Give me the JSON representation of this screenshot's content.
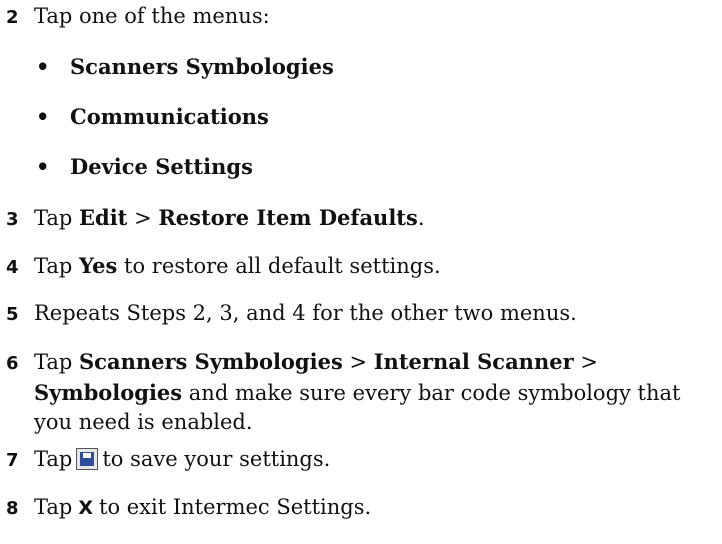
{
  "step2": {
    "num": "2",
    "text": "Tap one of the menus:",
    "bullets": [
      "Scanners Symbologies",
      "Communications",
      "Device Settings"
    ],
    "bullet_glyph": "•"
  },
  "step3": {
    "num": "3",
    "pre": "Tap ",
    "b1": "Edit",
    "sep": " > ",
    "b2": "Restore Item Defaults",
    "post": "."
  },
  "step4": {
    "num": "4",
    "pre": "Tap ",
    "b1": "Yes",
    "post": " to restore all default settings."
  },
  "step5": {
    "num": "5",
    "text": "Repeats Steps 2, 3, and 4 for the other two menus."
  },
  "step6": {
    "num": "6",
    "pre": "Tap ",
    "b1": "Scanners Symbologies",
    "sep1": " > ",
    "b2": "Internal Scanner",
    "sep2": " >",
    "b3": "Symbologies",
    "post_line2": " and make sure every bar code symbology that",
    "line3": "you need is enabled."
  },
  "step7": {
    "num": "7",
    "pre": "Tap",
    "icon": "save-icon",
    "post": "to save your settings."
  },
  "step8": {
    "num": "8",
    "pre": "Tap",
    "icon_glyph": "X",
    "post": "to exit Intermec Settings."
  }
}
